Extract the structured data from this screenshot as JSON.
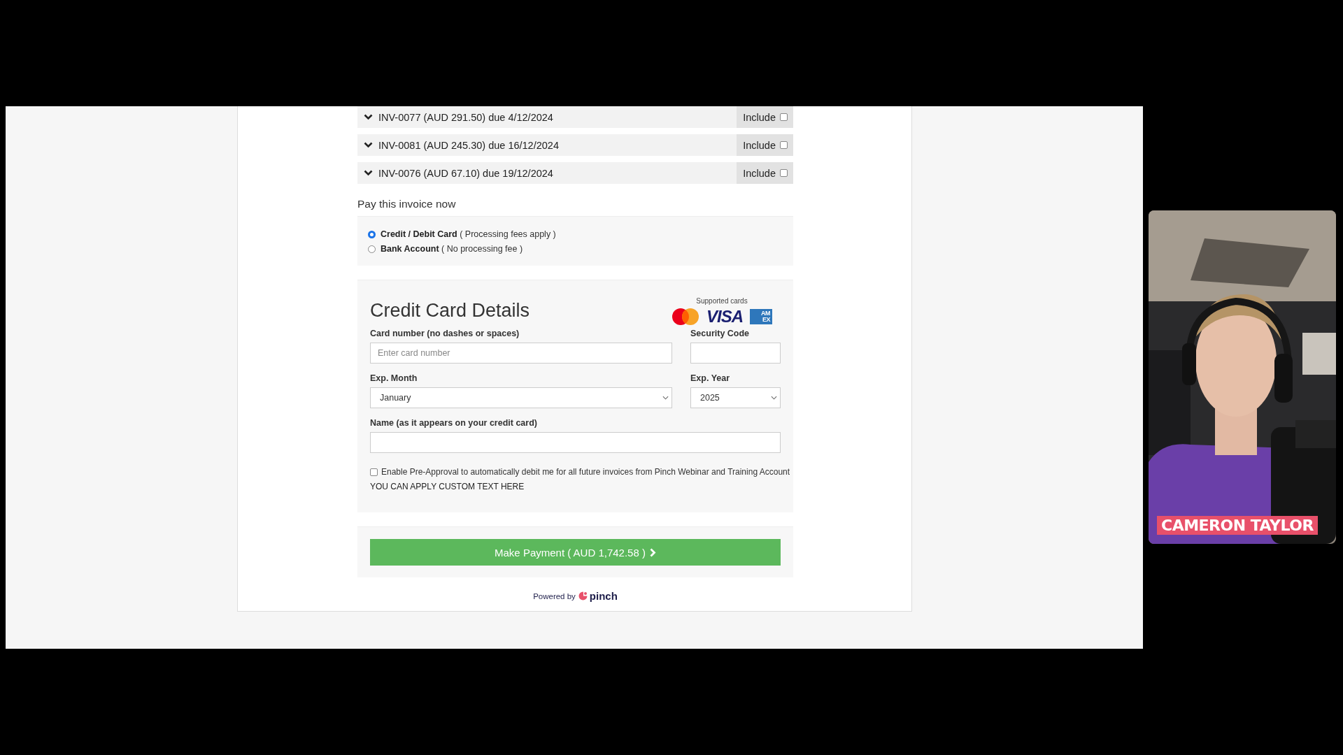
{
  "invoices": [
    {
      "label": "INV-0077 (AUD 291.50) due 4/12/2024",
      "include_label": "Include",
      "included": false
    },
    {
      "label": "INV-0081 (AUD 245.30) due 16/12/2024",
      "include_label": "Include",
      "included": false
    },
    {
      "label": "INV-0076 (AUD 67.10) due 19/12/2024",
      "include_label": "Include",
      "included": false
    }
  ],
  "payment": {
    "heading": "Pay this invoice now",
    "methods": [
      {
        "name": "Credit / Debit Card",
        "note": "( Processing fees apply )",
        "selected": true
      },
      {
        "name": "Bank Account",
        "note": "( No processing fee )",
        "selected": false
      }
    ]
  },
  "card_form": {
    "title": "Credit Card Details",
    "supported_label": "Supported cards",
    "cards": [
      {
        "kind": "mastercard"
      },
      {
        "kind": "visa",
        "text": "VISA"
      },
      {
        "kind": "amex",
        "lines": [
          "AM",
          "EX"
        ]
      }
    ],
    "card_number": {
      "label": "Card number (no dashes or spaces)",
      "placeholder": "Enter card number"
    },
    "security_code": {
      "label": "Security Code"
    },
    "exp_month": {
      "label": "Exp. Month",
      "value": "January"
    },
    "exp_year": {
      "label": "Exp. Year",
      "value": "2025"
    },
    "name": {
      "label": "Name (as it appears on your credit card)"
    },
    "pre_approval": {
      "label": "Enable Pre-Approval to automatically debit me for all future invoices from Pinch Webinar and Training Account",
      "checked": false
    },
    "custom_text": "YOU CAN APPLY CUSTOM TEXT HERE"
  },
  "pay_button": "Make Payment ( AUD 1,742.58 )",
  "footer": {
    "powered_by": "Powered by",
    "brand": "pinch"
  },
  "webcam": {
    "kind": "picture",
    "caption": "CAMERON TAYLOR"
  }
}
